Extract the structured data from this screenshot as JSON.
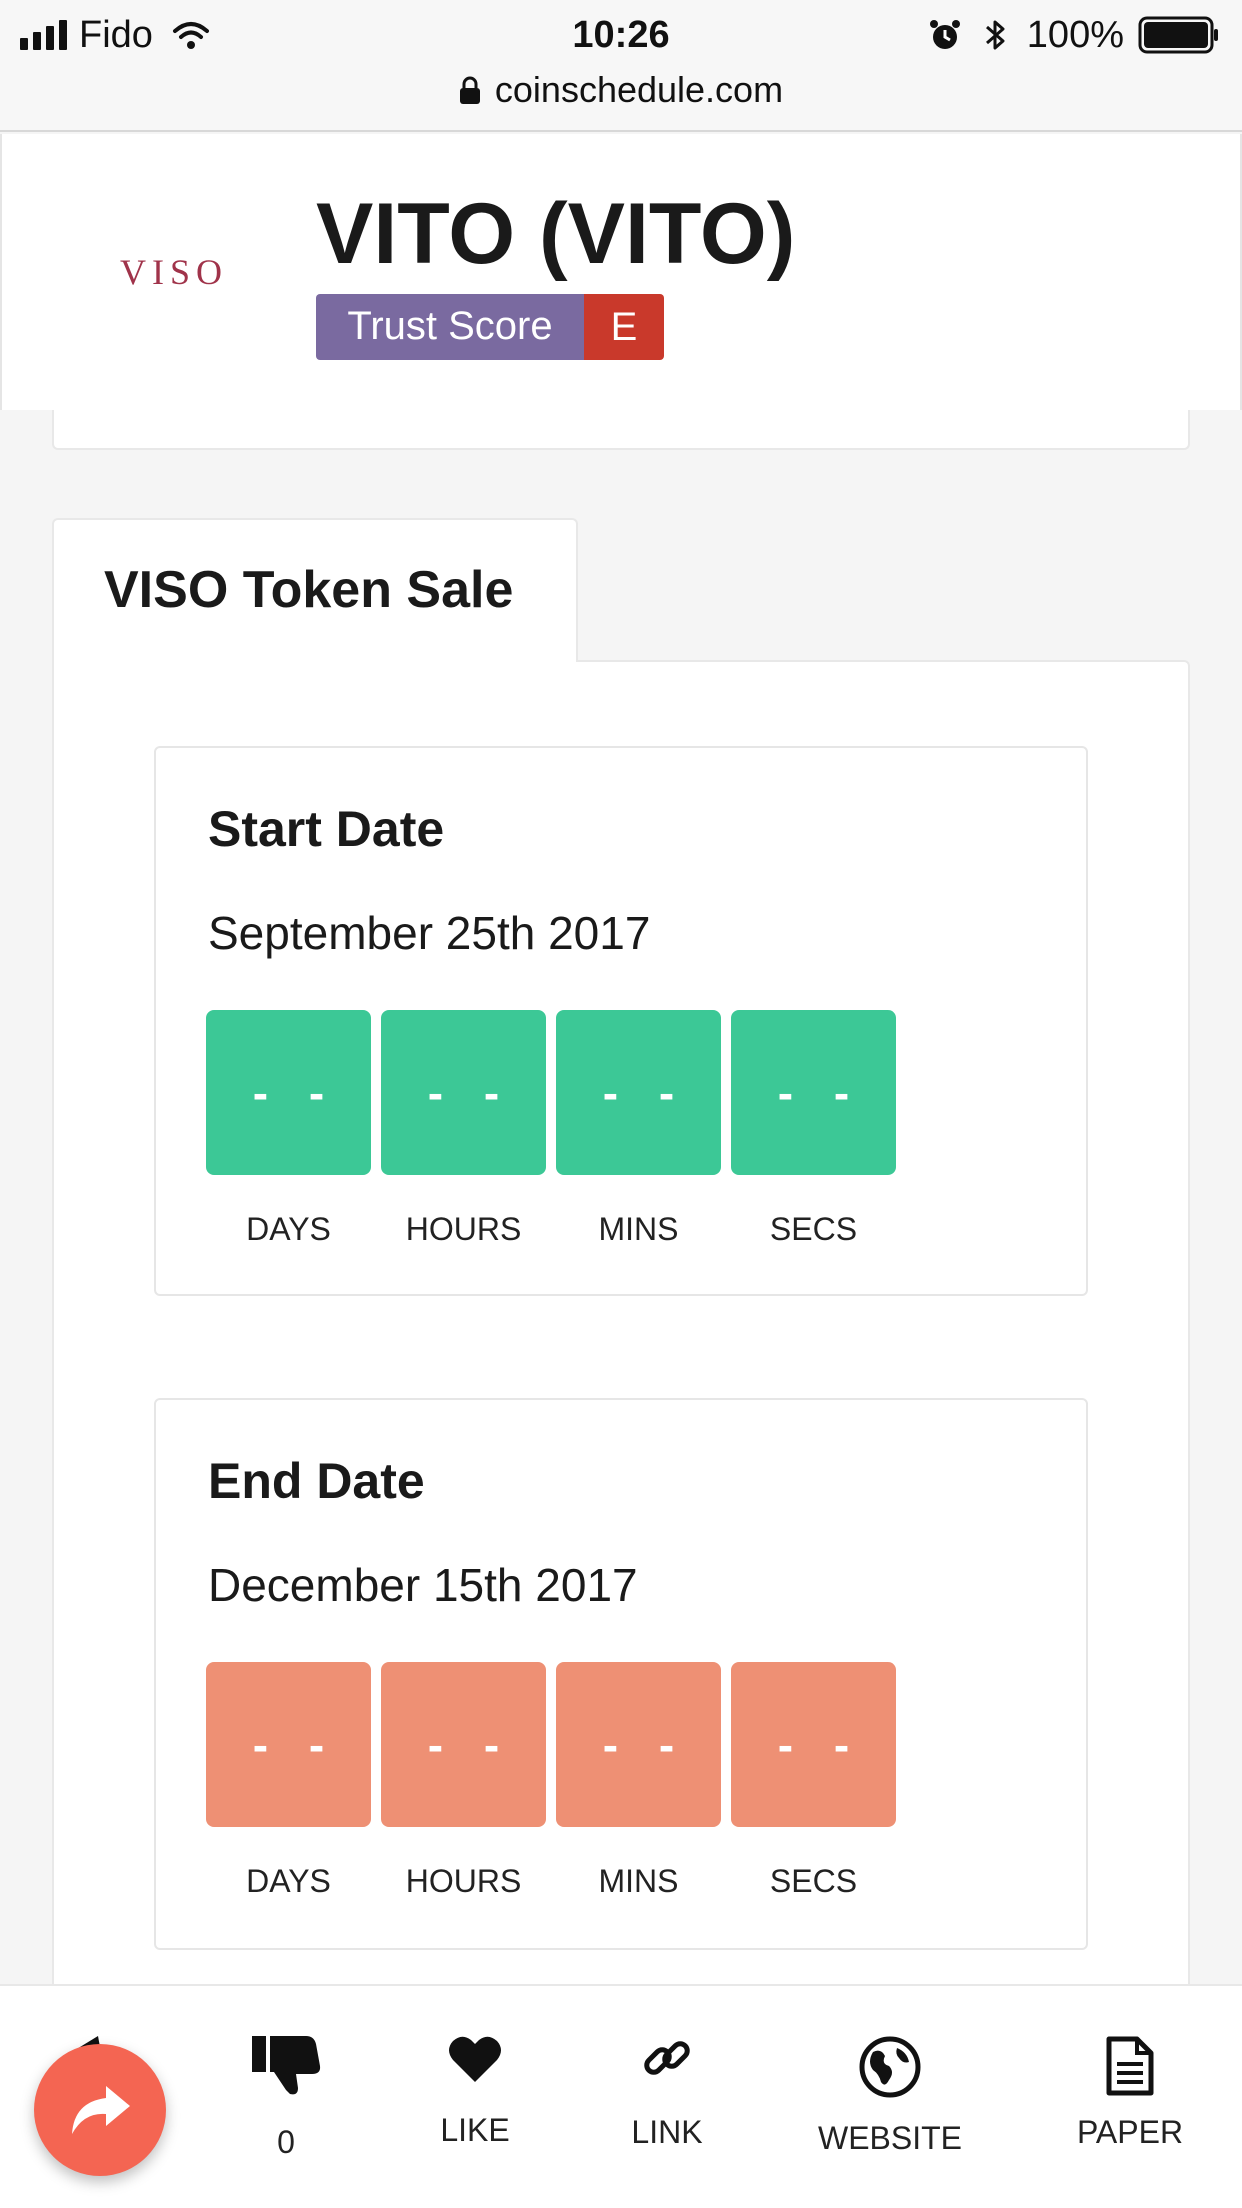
{
  "status_bar": {
    "carrier": "Fido",
    "time": "10:26",
    "battery": "100%",
    "icons": [
      "signal-icon",
      "wifi-icon",
      "alarm-icon",
      "bluetooth-icon",
      "battery-icon"
    ]
  },
  "browser": {
    "url": "coinschedule.com",
    "lock_icon": "lock-icon"
  },
  "header": {
    "logo_text": "VISO",
    "title": "VITO (VITO)",
    "trust_label": "Trust Score",
    "trust_grade": "E",
    "colors": {
      "trust": "#7a6aa0",
      "grade": "#c9392b"
    }
  },
  "tab": {
    "label": "VISO Token Sale"
  },
  "start": {
    "title": "Start Date",
    "date": "September 25th 2017",
    "color": "#3cc896",
    "units": [
      {
        "value": "- -",
        "label": "DAYS"
      },
      {
        "value": "- -",
        "label": "HOURS"
      },
      {
        "value": "- -",
        "label": "MINS"
      },
      {
        "value": "- -",
        "label": "SECS"
      }
    ]
  },
  "end": {
    "title": "End Date",
    "date": "December 15th 2017",
    "color": "#ee9074",
    "units": [
      {
        "value": "- -",
        "label": "DAYS"
      },
      {
        "value": "- -",
        "label": "HOURS"
      },
      {
        "value": "- -",
        "label": "MINS"
      },
      {
        "value": "- -",
        "label": "SECS"
      }
    ]
  },
  "toolbar": {
    "dislike_count": "0",
    "like_label": "LIKE",
    "link_label": "LINK",
    "website_label": "WEBSITE",
    "paper_label": "PAPER",
    "share_color": "#f46552"
  }
}
